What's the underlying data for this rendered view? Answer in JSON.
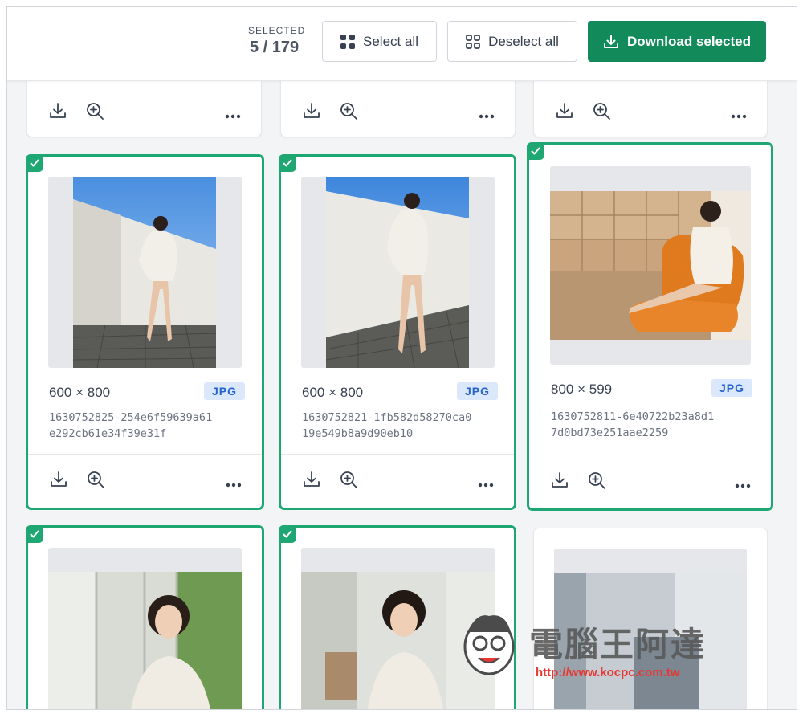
{
  "toolbar": {
    "selected_label": "SELECTED",
    "selected_count": "5 / 179",
    "select_all_label": "Select all",
    "deselect_all_label": "Deselect all",
    "download_selected_label": "Download selected",
    "accent_color": "#138a5a"
  },
  "cards": [
    {
      "selected": true,
      "dims": "600 × 800",
      "format": "JPG",
      "filename_line1": "1630752825-254e6f59639a61",
      "filename_line2": "e292cb61e34f39e31f"
    },
    {
      "selected": true,
      "dims": "600 × 800",
      "format": "JPG",
      "filename_line1": "1630752821-1fb582d58270ca0",
      "filename_line2": "19e549b8a9d90eb10"
    },
    {
      "selected": true,
      "dims": "800 × 599",
      "format": "JPG",
      "filename_line1": "1630752811-6e40722b23a8d1",
      "filename_line2": "7d0bd73e251aae2259"
    }
  ],
  "bottom_cards": [
    {
      "selected": true
    },
    {
      "selected": true
    },
    {
      "selected": false
    }
  ],
  "watermark": {
    "title": "電腦王阿達",
    "url": "http://www.kocpc.com.tw"
  },
  "icons": {
    "download": "download-icon",
    "zoom": "zoom-in-icon",
    "more": "more-icon",
    "check": "check-icon",
    "grid": "grid-icon"
  }
}
